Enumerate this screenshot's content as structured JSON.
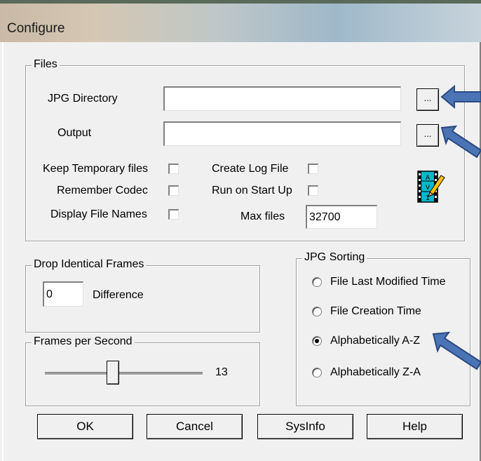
{
  "window": {
    "title": "Configure"
  },
  "files": {
    "legend": "Files",
    "jpg_directory_label": "JPG Directory",
    "jpg_directory_value": "",
    "output_label": "Output",
    "output_value": "",
    "browse_label": "...",
    "keep_temp_label": "Keep Temporary files",
    "remember_codec_label": "Remember Codec",
    "display_names_label": "Display File Names",
    "create_log_label": "Create Log File",
    "run_startup_label": "Run on Start Up",
    "max_files_label": "Max files",
    "max_files_value": "32700",
    "logo_letters": "AVI"
  },
  "drop": {
    "legend": "Drop Identical Frames",
    "value": "0",
    "difference_label": "Difference"
  },
  "fps": {
    "legend": "Frames per Second",
    "value": "13",
    "slider_fraction": 0.43
  },
  "sorting": {
    "legend": "JPG Sorting",
    "options": [
      {
        "label": "File Last Modified Time",
        "selected": false
      },
      {
        "label": "File Creation Time",
        "selected": false
      },
      {
        "label": "Alphabetically A-Z",
        "selected": true
      },
      {
        "label": "Alphabetically Z-A",
        "selected": false
      }
    ]
  },
  "buttons": {
    "ok": "OK",
    "cancel": "Cancel",
    "sysinfo": "SysInfo",
    "help": "Help"
  },
  "colors": {
    "arrow": "#4a74b5",
    "arrow_outline": "#2a4a80"
  }
}
